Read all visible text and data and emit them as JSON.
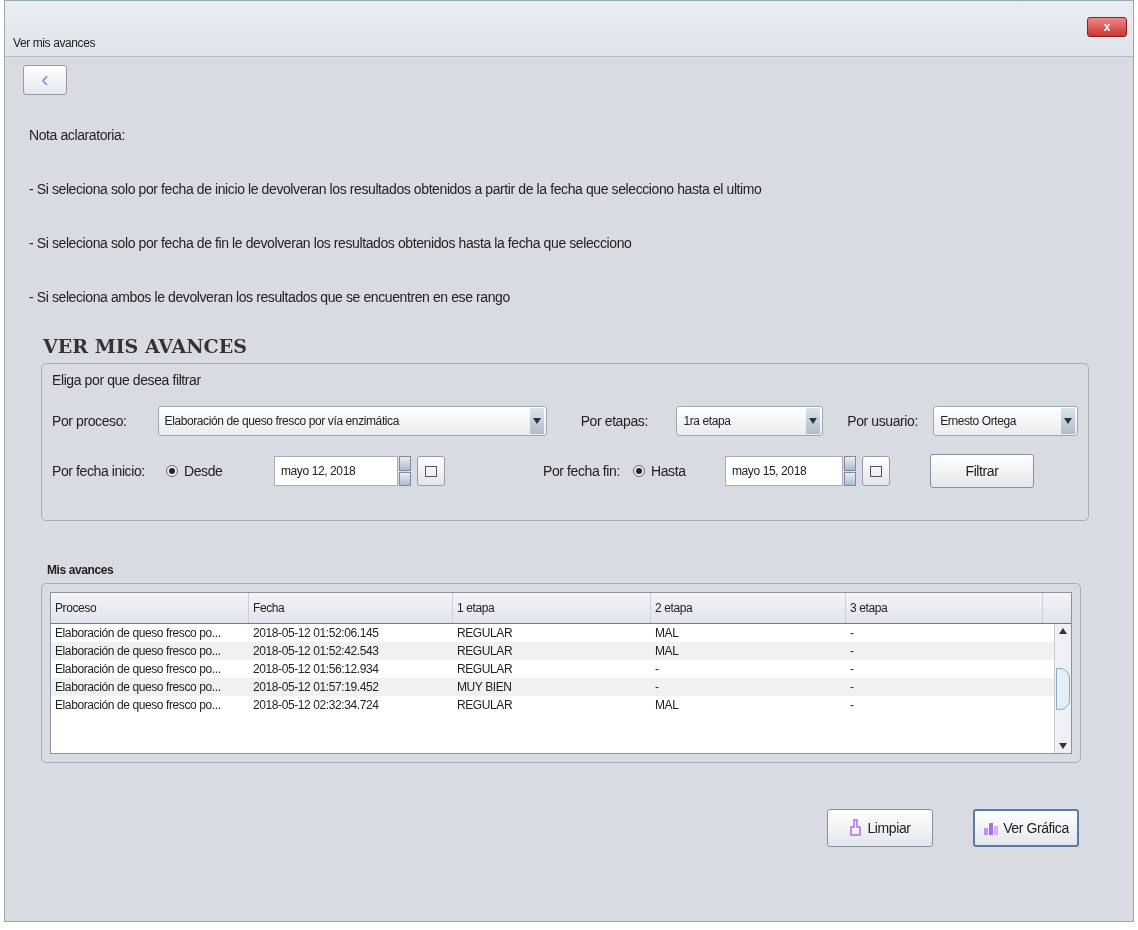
{
  "window": {
    "title": "Ver mis avances",
    "close": "x"
  },
  "back_button": {
    "label": "‹"
  },
  "note": {
    "title": "Nota aclaratoria:",
    "lines": [
      "- Si seleciona solo por fecha de inicio le devolveran los resultados obtenidos a partir de la fecha que selecciono hasta el ultimo",
      "- Si seleciona solo por fecha de fin le devolveran los resultados obtenidos hasta la fecha que selecciono",
      "- Si seleciona ambos le devolveran los resultados que se encuentren en ese rango"
    ]
  },
  "heading": "VER MIS AVANCES",
  "filter": {
    "title": "Eliga por que desea filtrar",
    "proceso": {
      "label": "Por proceso:",
      "value": "Elaboración de queso fresco por vía enzimática"
    },
    "etapas": {
      "label": "Por etapas:",
      "value": "1ra etapa"
    },
    "usuario": {
      "label": "Por usuario:",
      "value": "Ernesto Ortega"
    },
    "inicio": {
      "label": "Por fecha inicio:",
      "radio": "Desde",
      "selected": true,
      "date": "mayo 12, 2018"
    },
    "fin": {
      "label": "Por fecha fin:",
      "radio": "Hasta",
      "selected": true,
      "date": "mayo 15, 2018"
    },
    "button": "Filtrar"
  },
  "table": {
    "title": "Mis avances",
    "columns": [
      "Proceso",
      "Fecha",
      "1 etapa",
      "2 etapa",
      "3 etapa"
    ],
    "rows": [
      [
        "Elaboración de queso fresco po...",
        "2018-05-12 01:52:06.145",
        "REGULAR",
        "MAL",
        "-"
      ],
      [
        "Elaboración de queso fresco po...",
        "2018-05-12 01:52:42.543",
        "REGULAR",
        "MAL",
        "-"
      ],
      [
        "Elaboración de queso fresco po...",
        "2018-05-12 01:56:12.934",
        "REGULAR",
        "-",
        "-"
      ],
      [
        "Elaboración de queso fresco po...",
        "2018-05-12 01:57:19.452",
        "MUY BIEN",
        "-",
        "-"
      ],
      [
        "Elaboración de queso fresco po...",
        "2018-05-12 02:32:34.724",
        "REGULAR",
        "MAL",
        "-"
      ]
    ]
  },
  "buttons": [
    {
      "label": "Limpiar",
      "kind": "clear"
    },
    {
      "label": "Ver Gráfica",
      "kind": "chart"
    }
  ]
}
